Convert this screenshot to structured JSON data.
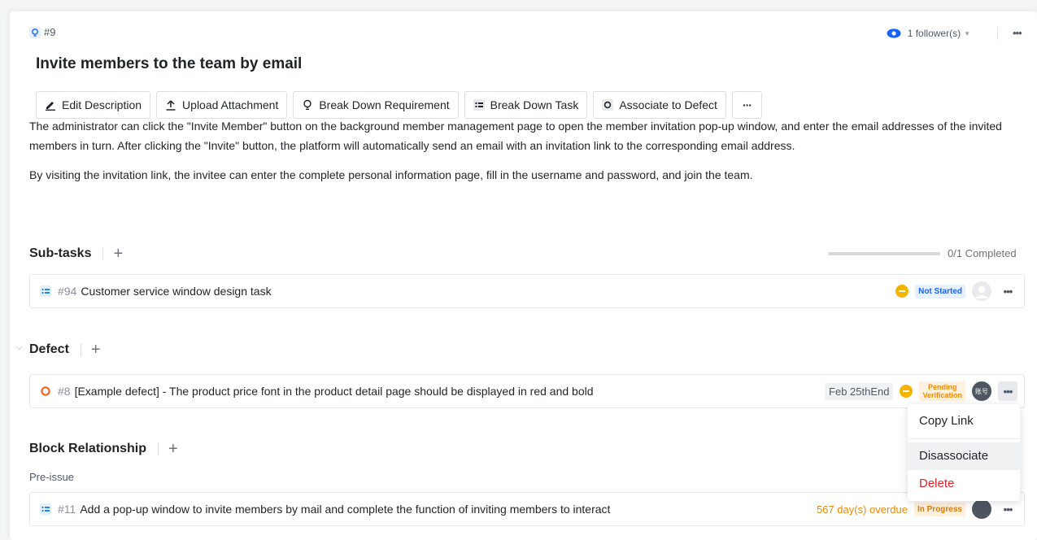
{
  "header": {
    "issue_id": "#9",
    "followers": "1 follower(s)",
    "title": "Invite members to the team by email"
  },
  "toolbar": {
    "edit_description": "Edit Description",
    "upload_attachment": "Upload Attachment",
    "break_down_requirement": "Break Down Requirement",
    "break_down_task": "Break Down Task",
    "associate_to_defect": "Associate to Defect",
    "more": "···"
  },
  "description": {
    "line1": "The administrator can click the \"Invite Member\" button on the background member management page to open the member invitation pop-up window, and enter the email addresses of the invited members in turn. After clicking the \"Invite\" button, the platform will automatically send an email with an invitation link to the corresponding email address.",
    "line2": "By visiting the invitation link, the invitee can enter the complete personal information page, fill in the username and password, and join the team."
  },
  "subtasks": {
    "heading": "Sub-tasks",
    "add": "+",
    "progress": "0/1 Completed",
    "progress_fraction": 0,
    "items": [
      {
        "id": "#94",
        "title": "Customer service window design task",
        "status": "Not Started"
      }
    ]
  },
  "defect": {
    "heading": "Defect",
    "add": "+",
    "items": [
      {
        "id": "#8",
        "title": "[Example defect] - The product price font in the product detail page should be displayed in red and bold",
        "date": "Feb 25thEnd",
        "status_line1": "Pending",
        "status_line2": "Verification",
        "avatar": "账号"
      }
    ]
  },
  "block": {
    "heading": "Block Relationship",
    "add": "+",
    "sublabel": "Pre-issue",
    "items": [
      {
        "id": "#11",
        "title": "Add a pop-up window to invite members by mail and complete the function of inviting members to interact",
        "overdue": "567 day(s) overdue",
        "status": "In Progress"
      }
    ]
  },
  "context_menu": {
    "copy_link": "Copy Link",
    "disassociate": "Disassociate",
    "delete": "Delete"
  },
  "colors": {
    "accent": "#1664ff",
    "warning": "#f08a00",
    "danger": "#e5252a",
    "task_icon": "#1e88e5",
    "defect_icon": "#f26522"
  }
}
